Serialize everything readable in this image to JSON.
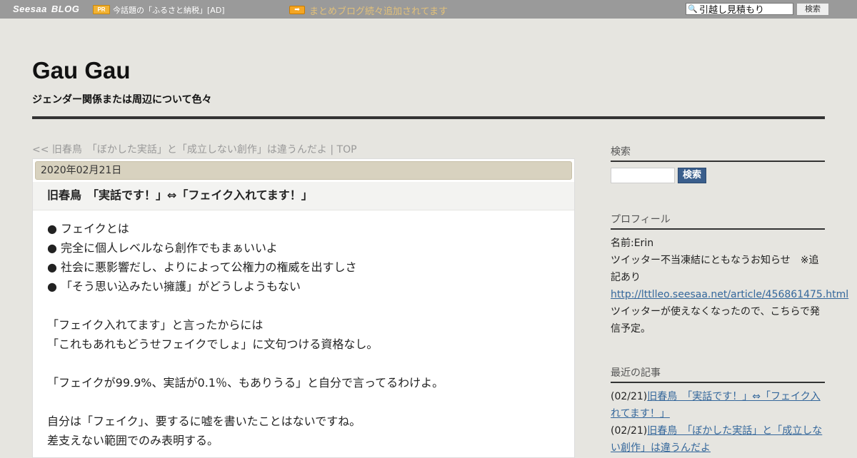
{
  "topbar": {
    "logo": "Seesaa",
    "logo_blog": "BLOG",
    "pr_badge": "PR",
    "ad_text": "今話題の「ふるさと納税」[AD]",
    "arrow_icon": "arrow-right-icon",
    "notice": "まとめブログ続々追加されてます",
    "search_value": "引越し見積もり",
    "search_button": "検索"
  },
  "header": {
    "title": "Gau Gau",
    "description": "ジェンダー関係または周辺について色々"
  },
  "breadcrumb": "<< 旧春鳥　「ぼかした実話」と「成立しない創作」は違うんだよ | TOP",
  "article": {
    "date": "2020年02月21日",
    "title": "旧春鳥　「実話です！」⇔「フェイク入れてます！」",
    "lines": [
      "● フェイクとは",
      "● 完全に個人レベルなら創作でもまぁいいよ",
      "● 社会に悪影響だし、よりによって公権力の権威を出すしさ",
      "● 「そう思い込みたい擁護」がどうしようもない",
      "",
      "「フェイク入れてます」と言ったからには",
      "「これもあれもどうせフェイクでしょ」に文句つける資格なし。",
      "",
      "「フェイクが99.9%、実話が0.1％、もありうる」と自分で言ってるわけよ。",
      "",
      "自分は「フェイク」、要するに嘘を書いたことはないですね。",
      "差支えない範囲でのみ表明する。"
    ]
  },
  "sidebar": {
    "search_heading": "検索",
    "search_button": "検索",
    "profile_heading": "プロフィール",
    "profile_name": "名前:Erin",
    "profile_note": "ツイッター不当凍結にともなうお知らせ　※追記あり",
    "profile_link": "http://lttlleo.seesaa.net/article/456861475.html",
    "profile_note2": "ツイッターが使えなくなったので、こちらで発信予定。",
    "recent_heading": "最近の記事",
    "recent": [
      {
        "date": "(02/21)",
        "title": "旧春鳥　「実話です！」⇔「フェイク入れてます！」"
      },
      {
        "date": "(02/21)",
        "title": "旧春鳥　「ぼかした実話」と「成立しない創作」は違うんだよ"
      }
    ]
  }
}
